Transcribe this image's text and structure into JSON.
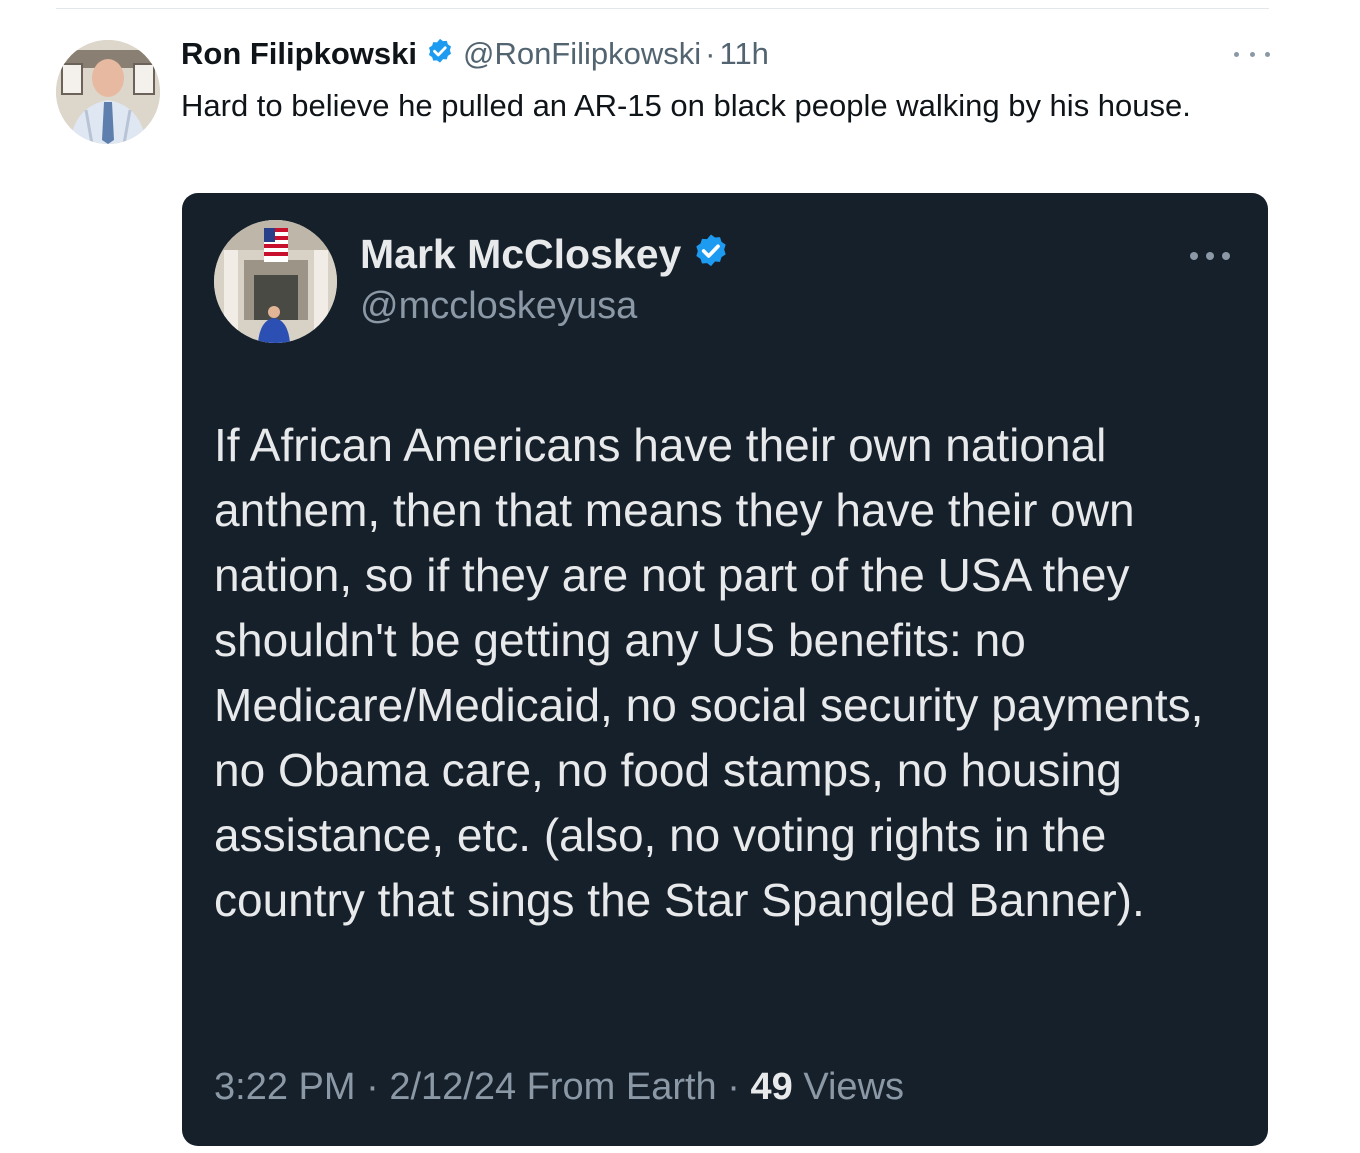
{
  "outer_tweet": {
    "author_name": "Ron Filipkowski",
    "handle": "@RonFilipkowski",
    "separator": "·",
    "time": "11h",
    "text": "Hard to believe he pulled an AR-15 on black people walking by his house.",
    "menu_icon": "more-horizontal-icon"
  },
  "quoted_tweet": {
    "author_name": "Mark McCloskey",
    "handle": "@mccloskeyusa",
    "text": "If African Americans have their own national anthem, then that means they have their own nation, so if they are not part of the USA they shouldn't be getting any US benefits: no Medicare/Medicaid, no social security payments, no Obama care, no food stamps, no housing assistance, etc. (also, no voting rights in the country that sings the Star Spangled Banner).",
    "time": "3:22 PM",
    "sep1": "·",
    "date_source": "2/12/24 From Earth",
    "sep2": "·",
    "views_count": "49",
    "views_label": "Views",
    "menu_icon": "more-horizontal-icon"
  },
  "colors": {
    "verified_blue": "#1d9bf0",
    "card_background": "#16202b",
    "text_dark": "#0f1419",
    "text_muted": "#536471"
  }
}
